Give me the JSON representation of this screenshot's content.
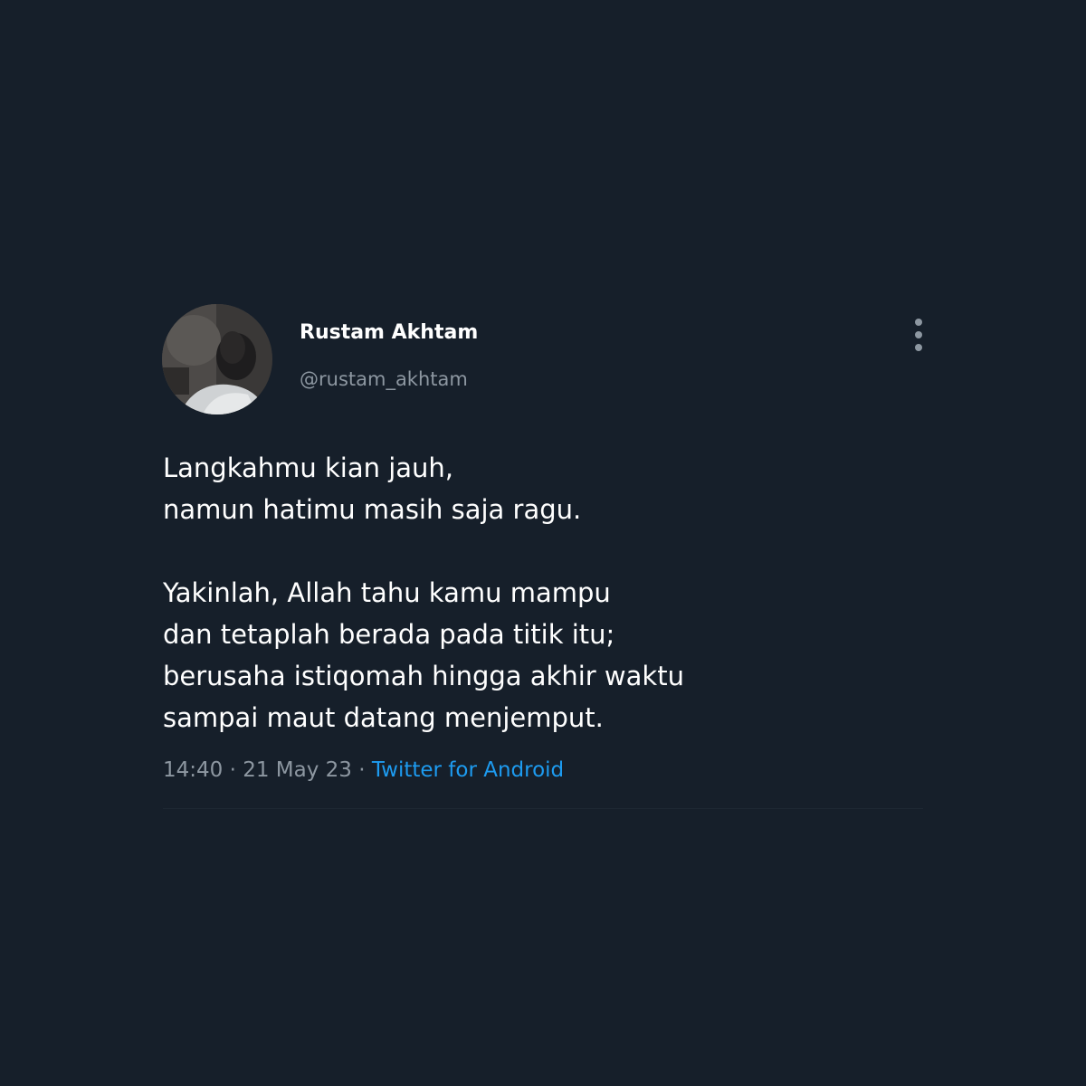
{
  "user": {
    "display_name": "Rustam Akhtam",
    "handle": "@rustam_akhtam",
    "avatar_icon": "profile-photo"
  },
  "menu": {
    "icon": "more-vertical-icon"
  },
  "tweet": {
    "lines": [
      "Langkahmu kian jauh,",
      "namun hatimu masih saja ragu.",
      "",
      "Yakinlah, Allah tahu kamu mampu",
      "dan tetaplah berada pada titik itu;",
      "berusaha istiqomah hingga akhir waktu",
      "sampai maut datang menjemput."
    ]
  },
  "meta": {
    "time": "14:40",
    "separator": " · ",
    "date": "21 May 23",
    "source": "Twitter for Android"
  },
  "colors": {
    "background": "#161f2a",
    "text": "#ffffff",
    "secondary": "#8d97a1",
    "link": "#1d9bf0"
  }
}
